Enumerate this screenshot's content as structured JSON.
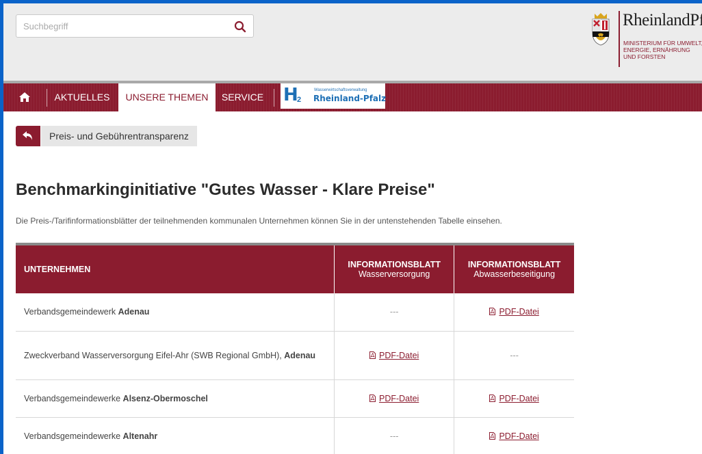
{
  "search": {
    "placeholder": "Suchbegriff"
  },
  "logo": {
    "title": "Rheinland⁠Pfal",
    "subtitle_line1": "MINISTERIUM FÜR UMWELT,",
    "subtitle_line2": "ENERGIE, ERNÄHRUNG",
    "subtitle_line3": "UND FORSTEN"
  },
  "nav": {
    "items": [
      {
        "label": "AKTUELLES"
      },
      {
        "label": "UNSERE THEMEN"
      },
      {
        "label": "SERVICE"
      }
    ],
    "partner_logo": {
      "mark": "H",
      "mark_sub": "2",
      "small": "Wasserwirtschaftsverwaltung",
      "big": "Rheinland-Pfalz"
    }
  },
  "breadcrumb": {
    "label": "Preis- und Gebührentransparenz"
  },
  "page": {
    "title": "Benchmarkinginitiative \"Gutes Wasser - Klare Preise\"",
    "intro": "Die Preis-/Tarifinformationsblätter der teilnehmenden kommunalen Unternehmen können Sie in der untenstehenden Tabelle einsehen."
  },
  "table": {
    "headers": {
      "name": "UNTERNEHMEN",
      "water_title": "INFORMATIONSBLATT",
      "water_sub": "Wasserversorgung",
      "waste_title": "INFORMATIONSBLATT",
      "waste_sub": "Abwasserbeseitigung"
    },
    "rows": [
      {
        "prefix": "Verbandsgemeindewerk ",
        "bold": "Adenau",
        "water": "---",
        "waste": "PDF-Datei"
      },
      {
        "prefix": "Zweckverband Wasserversorgung Eifel-Ahr (SWB Regional GmbH), ",
        "bold": "Adenau",
        "water": "PDF-Datei",
        "waste": "---"
      },
      {
        "prefix": "Verbandsgemeindewerke ",
        "bold": "Alsenz-Obermoschel",
        "water": "PDF-Datei",
        "waste": "PDF-Datei"
      },
      {
        "prefix": "Verbandsgemeindewerke ",
        "bold": "Altenahr",
        "water": "---",
        "waste": "PDF-Datei"
      }
    ]
  },
  "colors": {
    "brand": "#8b1c2f",
    "frame": "#0a63c9",
    "header_bg": "#ececec"
  }
}
